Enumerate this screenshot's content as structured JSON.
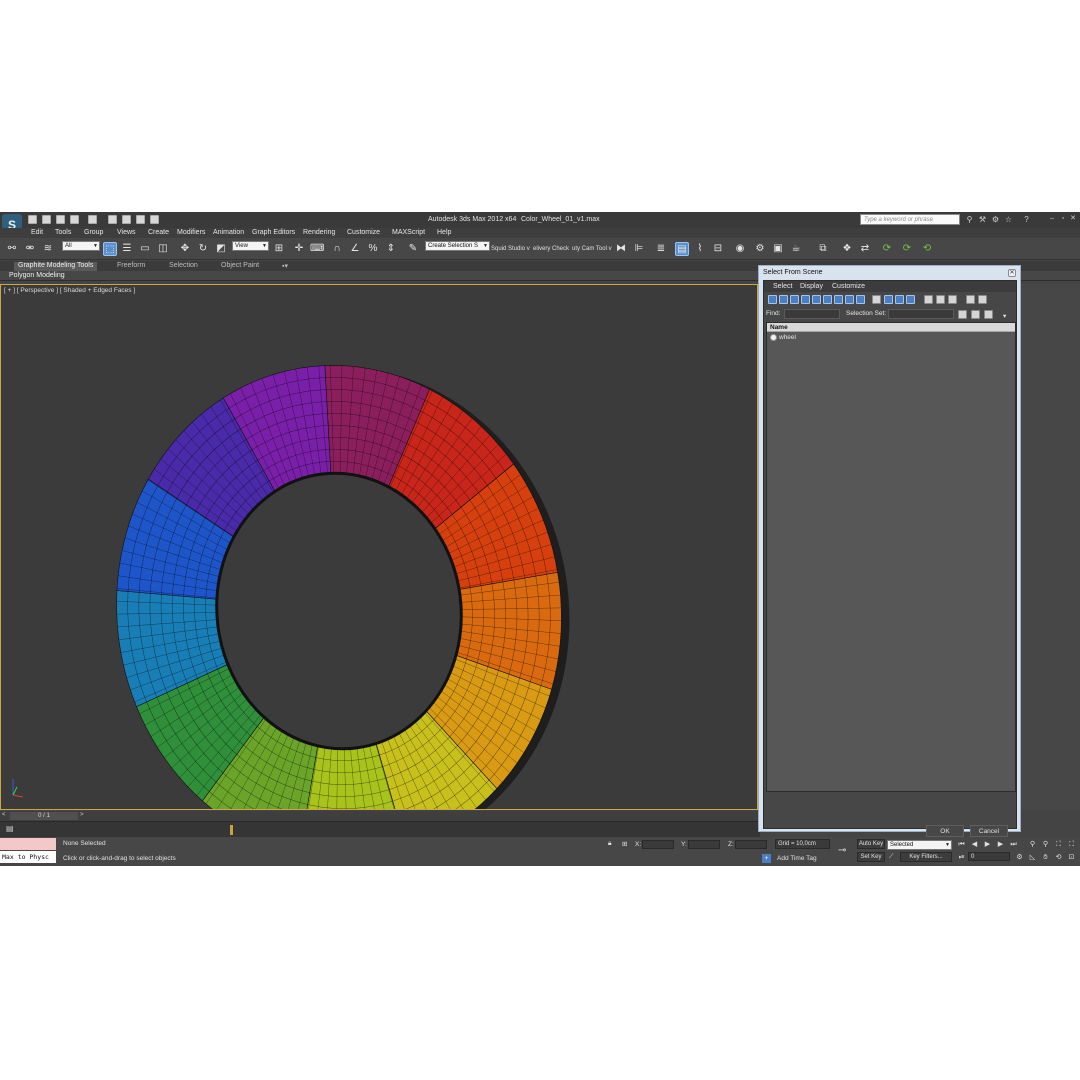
{
  "titlebar": {
    "app_title": "Autodesk 3ds Max  2012 x64",
    "file_name": "Color_Wheel_01_v1.max",
    "search_placeholder": "Type a keyword or phrase",
    "logo_glyph": "S",
    "help_glyph": "?"
  },
  "menu": {
    "items": [
      "Edit",
      "Tools",
      "Group",
      "Views",
      "Create",
      "Modifiers",
      "Animation",
      "Graph Editors",
      "Rendering",
      "Customize",
      "MAXScript",
      "Help"
    ]
  },
  "toolbar": {
    "filter_value": "All",
    "refcoord_value": "View",
    "named_selection_placeholder": "Create Selection S",
    "script_1": "Squid Studio v",
    "script_2": "elivery Check",
    "script_3": "uty Cam Tool v"
  },
  "ribbon": {
    "tabs": [
      "Graphite Modeling Tools",
      "Freeform",
      "Selection",
      "Object Paint"
    ],
    "sub_label": "Polygon Modeling"
  },
  "viewport": {
    "label": "[ + ] [ Perspective ] [ Shaded + Edged Faces ]",
    "wheel_colors": [
      "#8b1f5e",
      "#c8261a",
      "#d6400f",
      "#d96a10",
      "#d99a14",
      "#c8c01c",
      "#a8c41c",
      "#6aa52a",
      "#2f8f3a",
      "#1a7eb6",
      "#1e56c9",
      "#4a2aa8",
      "#7a1fa8"
    ]
  },
  "timeline": {
    "frame": "0 / 1",
    "prev": "<",
    "next": ">"
  },
  "status": {
    "maxscript": "Max to Physc",
    "selection": "None Selected",
    "prompt": "Click or click-and-drag to select objects",
    "x_label": "X:",
    "y_label": "Y:",
    "z_label": "Z:",
    "grid": "Grid = 10,0cm",
    "add_time_tag": "Add Time Tag",
    "auto_key": "Auto Key",
    "set_key": "Set Key",
    "key_mode": "Selected",
    "key_filters": "Key Filters...",
    "frame_field": "0"
  },
  "dialog": {
    "title": "Select From Scene",
    "menu": [
      "Select",
      "Display",
      "Customize"
    ],
    "find_label": "Find:",
    "selection_set_label": "Selection Set:",
    "column_name": "Name",
    "objects": [
      "wheel"
    ],
    "ok": "OK",
    "cancel": "Cancel"
  }
}
